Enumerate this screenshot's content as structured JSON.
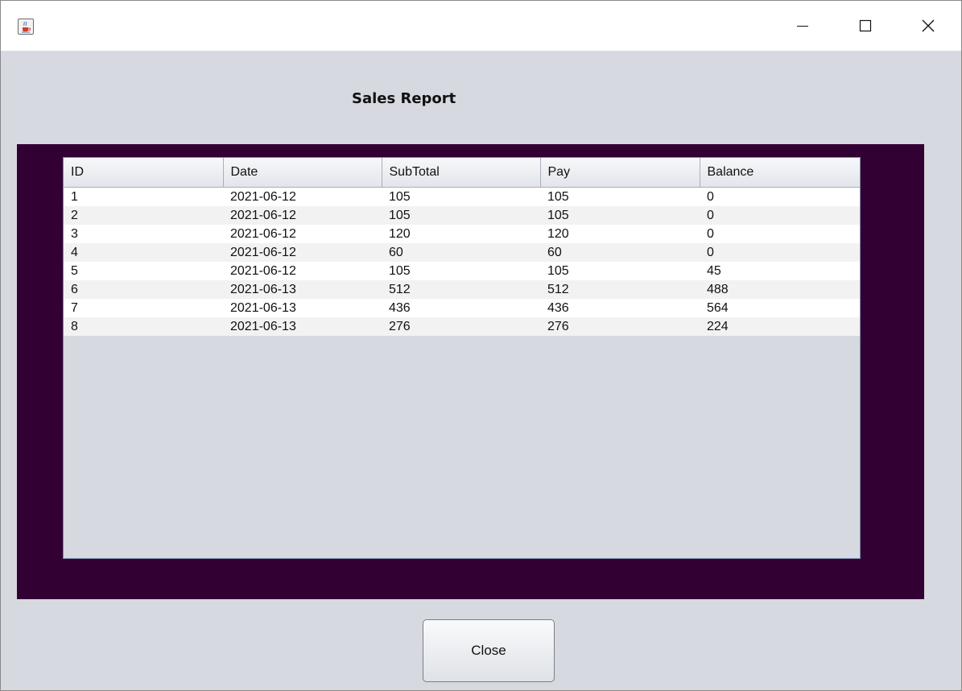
{
  "window": {
    "icon": "java-cup-icon",
    "controls": {
      "minimize_glyph": "—",
      "maximize_glyph": "☐",
      "close_glyph": "✕"
    }
  },
  "heading": "Sales Report",
  "table": {
    "columns": [
      "ID",
      "Date",
      "SubTotal",
      "Pay",
      "Balance"
    ],
    "rows": [
      [
        "1",
        "2021-06-12",
        "105",
        "105",
        "0"
      ],
      [
        "2",
        "2021-06-12",
        "105",
        "105",
        "0"
      ],
      [
        "3",
        "2021-06-12",
        "120",
        "120",
        "0"
      ],
      [
        "4",
        "2021-06-12",
        "60",
        "60",
        "0"
      ],
      [
        "5",
        "2021-06-12",
        "105",
        "105",
        "45"
      ],
      [
        "6",
        "2021-06-13",
        "512",
        "512",
        "488"
      ],
      [
        "7",
        "2021-06-13",
        "436",
        "436",
        "564"
      ],
      [
        "8",
        "2021-06-13",
        "276",
        "276",
        "224"
      ]
    ]
  },
  "footer": {
    "close_label": "Close"
  },
  "colors": {
    "panel": "#330033",
    "window_bg": "#d6d9df"
  }
}
